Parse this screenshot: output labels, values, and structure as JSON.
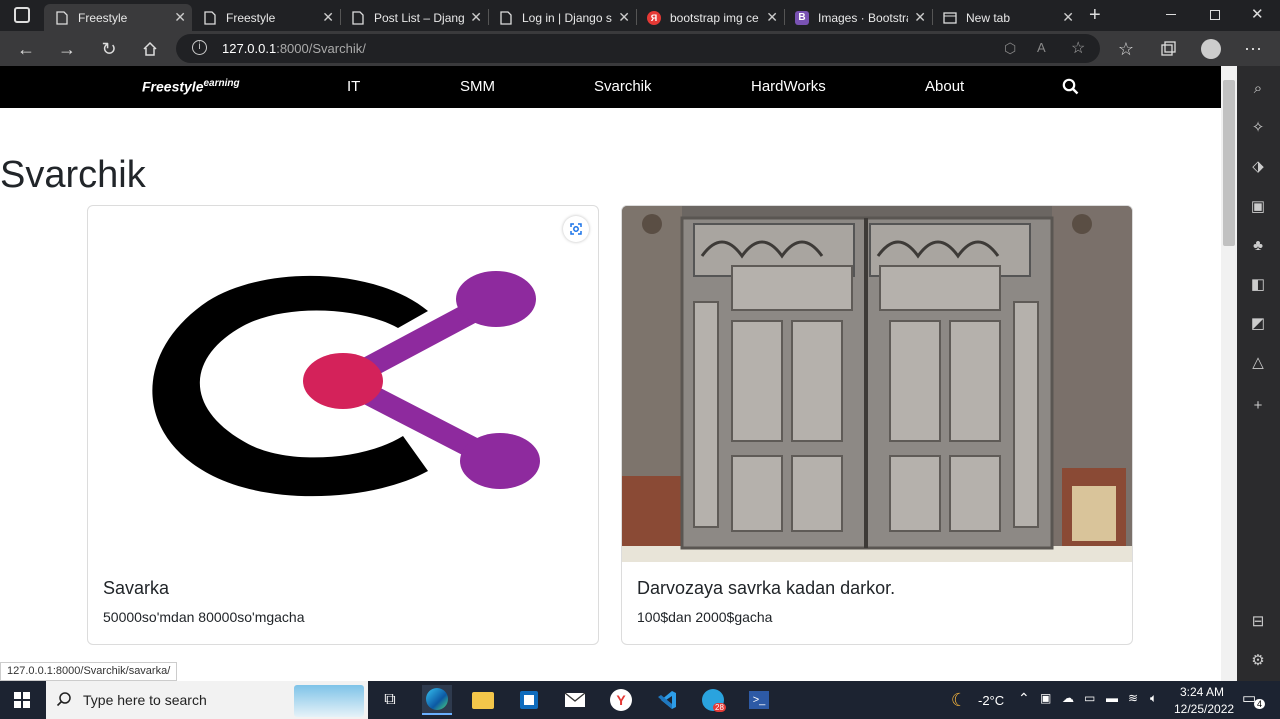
{
  "browser": {
    "tabs": [
      {
        "title": "Freestyle",
        "active": true
      },
      {
        "title": "Freestyle",
        "active": false
      },
      {
        "title": "Post List – Django",
        "active": false
      },
      {
        "title": "Log in | Django si",
        "active": false
      },
      {
        "title": "bootstrap img ce",
        "active": false
      },
      {
        "title": "Images · Bootstra",
        "active": false
      },
      {
        "title": "New tab",
        "active": false
      }
    ],
    "url_host": "127.0.0.1",
    "url_rest": ":8000/Svarchik/",
    "status_link": "127.0.0.1:8000/Svarchik/savarka/"
  },
  "site": {
    "brand": "Freestyle",
    "brand_sup": "earning",
    "nav": [
      "IT",
      "SMM",
      "Svarchik",
      "HardWorks",
      "About"
    ],
    "page_title": "Svarchik",
    "cards": [
      {
        "title": "Savarka",
        "text": "50000so'mdan 80000so'mgacha"
      },
      {
        "title": "Darvozaya savrka kadan darkor.",
        "text": "100$dan 2000$gacha"
      }
    ]
  },
  "taskbar": {
    "search_placeholder": "Type here to search",
    "weather": "-2°C",
    "time": "3:24 AM",
    "date": "12/25/2022",
    "telegram_badge": "28",
    "notif_count": "4"
  },
  "colors": {
    "logo_c": "#000000",
    "logo_node": "#d4225a",
    "logo_branch": "#8e2a9e",
    "navbar_bg": "#000000"
  }
}
